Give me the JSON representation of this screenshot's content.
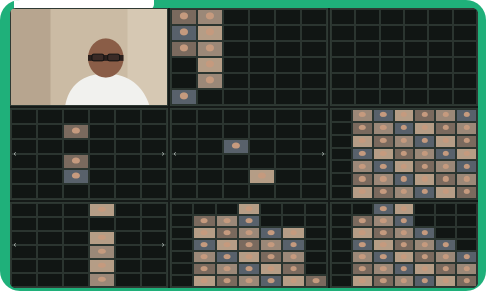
{
  "window": {
    "kind": "video-conference-gallery",
    "panels": 6
  },
  "colors": {
    "frame": "#1fb07a",
    "background": "#151a18",
    "tile": "#111614",
    "name_text": "#d8e0dc"
  },
  "main_panel": {
    "name_label": ""
  },
  "grid_panels": [
    {
      "id": "top-middle"
    },
    {
      "id": "top-right"
    },
    {
      "id": "middle-left"
    },
    {
      "id": "middle-center"
    },
    {
      "id": "middle-right"
    },
    {
      "id": "bottom-left"
    },
    {
      "id": "bottom-center"
    },
    {
      "id": "bottom-right"
    }
  ],
  "navigation": {
    "prev_icon": "chevron-left-icon",
    "next_icon": "chevron-right-icon"
  }
}
